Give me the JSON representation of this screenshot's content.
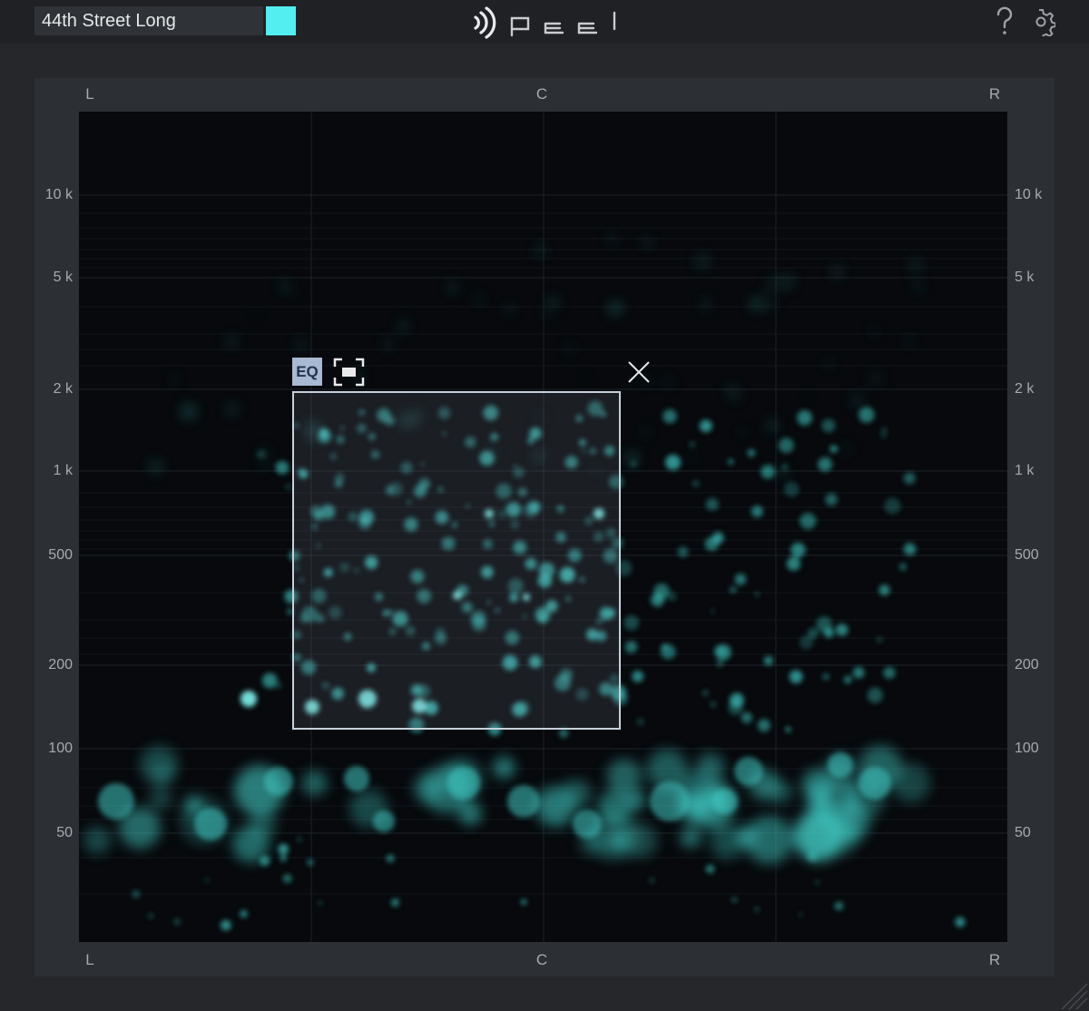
{
  "header": {
    "preset_name": "44th Street Long",
    "swatch_color": "#52eef0",
    "logo_icon": "sound-waves-icon",
    "logo_text": "peel",
    "help_icon": "question-icon",
    "settings_icon": "gear-icon"
  },
  "pan_axis": {
    "left": "L",
    "center": "C",
    "right": "R"
  },
  "freq_axis": [
    "10 k",
    "5 k",
    "2 k",
    "1 k",
    "500",
    "200",
    "100",
    "50"
  ],
  "selection": {
    "eq_label": "EQ",
    "isolate_icon": "focus-frame-icon",
    "close_icon": "close-icon"
  },
  "colors": {
    "accent": "#52eef0",
    "particle": "#3fc9c3",
    "selection_border": "#c7d1dc",
    "eq_button": "#a8b9d3"
  }
}
